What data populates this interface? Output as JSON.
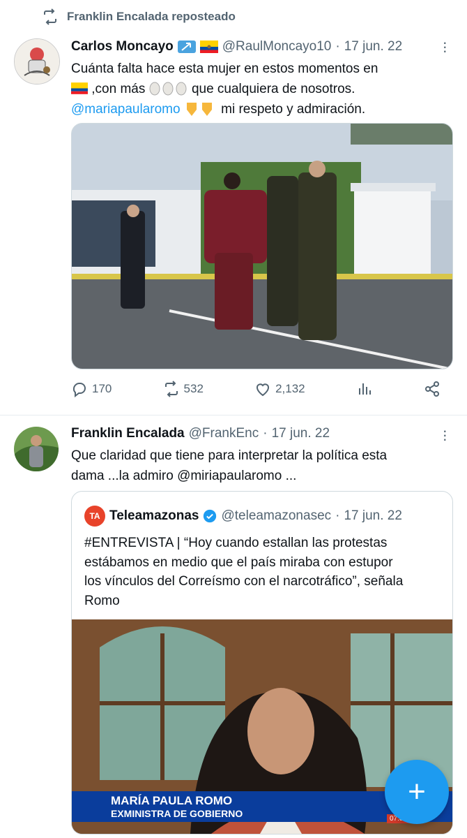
{
  "repost_banner": {
    "text": "Franklin Encalada reposteado"
  },
  "tweet1": {
    "name": "Carlos Moncayo",
    "handle": "@RaulMoncayo10",
    "sep": "·",
    "date": "17 jun. 22",
    "line1": "Cuánta falta hace esta mujer en estos momentos en",
    "line2_after_flag": ",con más",
    "line2_tail": "que cualquiera de nosotros.",
    "mention": "@mariapaularomo",
    "line3_tail": "mi respeto y admiración.",
    "replies": "170",
    "reposts": "532",
    "likes": "2,132"
  },
  "tweet2": {
    "name": "Franklin Encalada",
    "handle": "@FrankEnc",
    "sep": "·",
    "date": "17 jun. 22",
    "line1": "Que claridad que tiene para interpretar la política esta",
    "line2": "dama ...la admiro @miriapaularomo ..."
  },
  "quote": {
    "logo_text": "TA",
    "name": "Teleamazonas",
    "handle": "@teleamazonasec",
    "sep": "·",
    "date": "17 jun. 22",
    "line1": "#ENTREVISTA | “Hoy cuando estallan las protestas",
    "line2": "estábamos en medio que el país miraba con estupor",
    "line3": "los vínculos del Correísmo con el narcotráfico”, señala",
    "line4": "Romo",
    "lower_third_name": "MARÍA PAULA ROMO",
    "lower_third_title": "EXMINISTRA DE GOBIERNO",
    "time": "07:38"
  },
  "fab": {
    "symbol": "+"
  },
  "colors": {
    "accent": "#1d9bf0",
    "muted": "#536471",
    "text": "#0f1419"
  }
}
